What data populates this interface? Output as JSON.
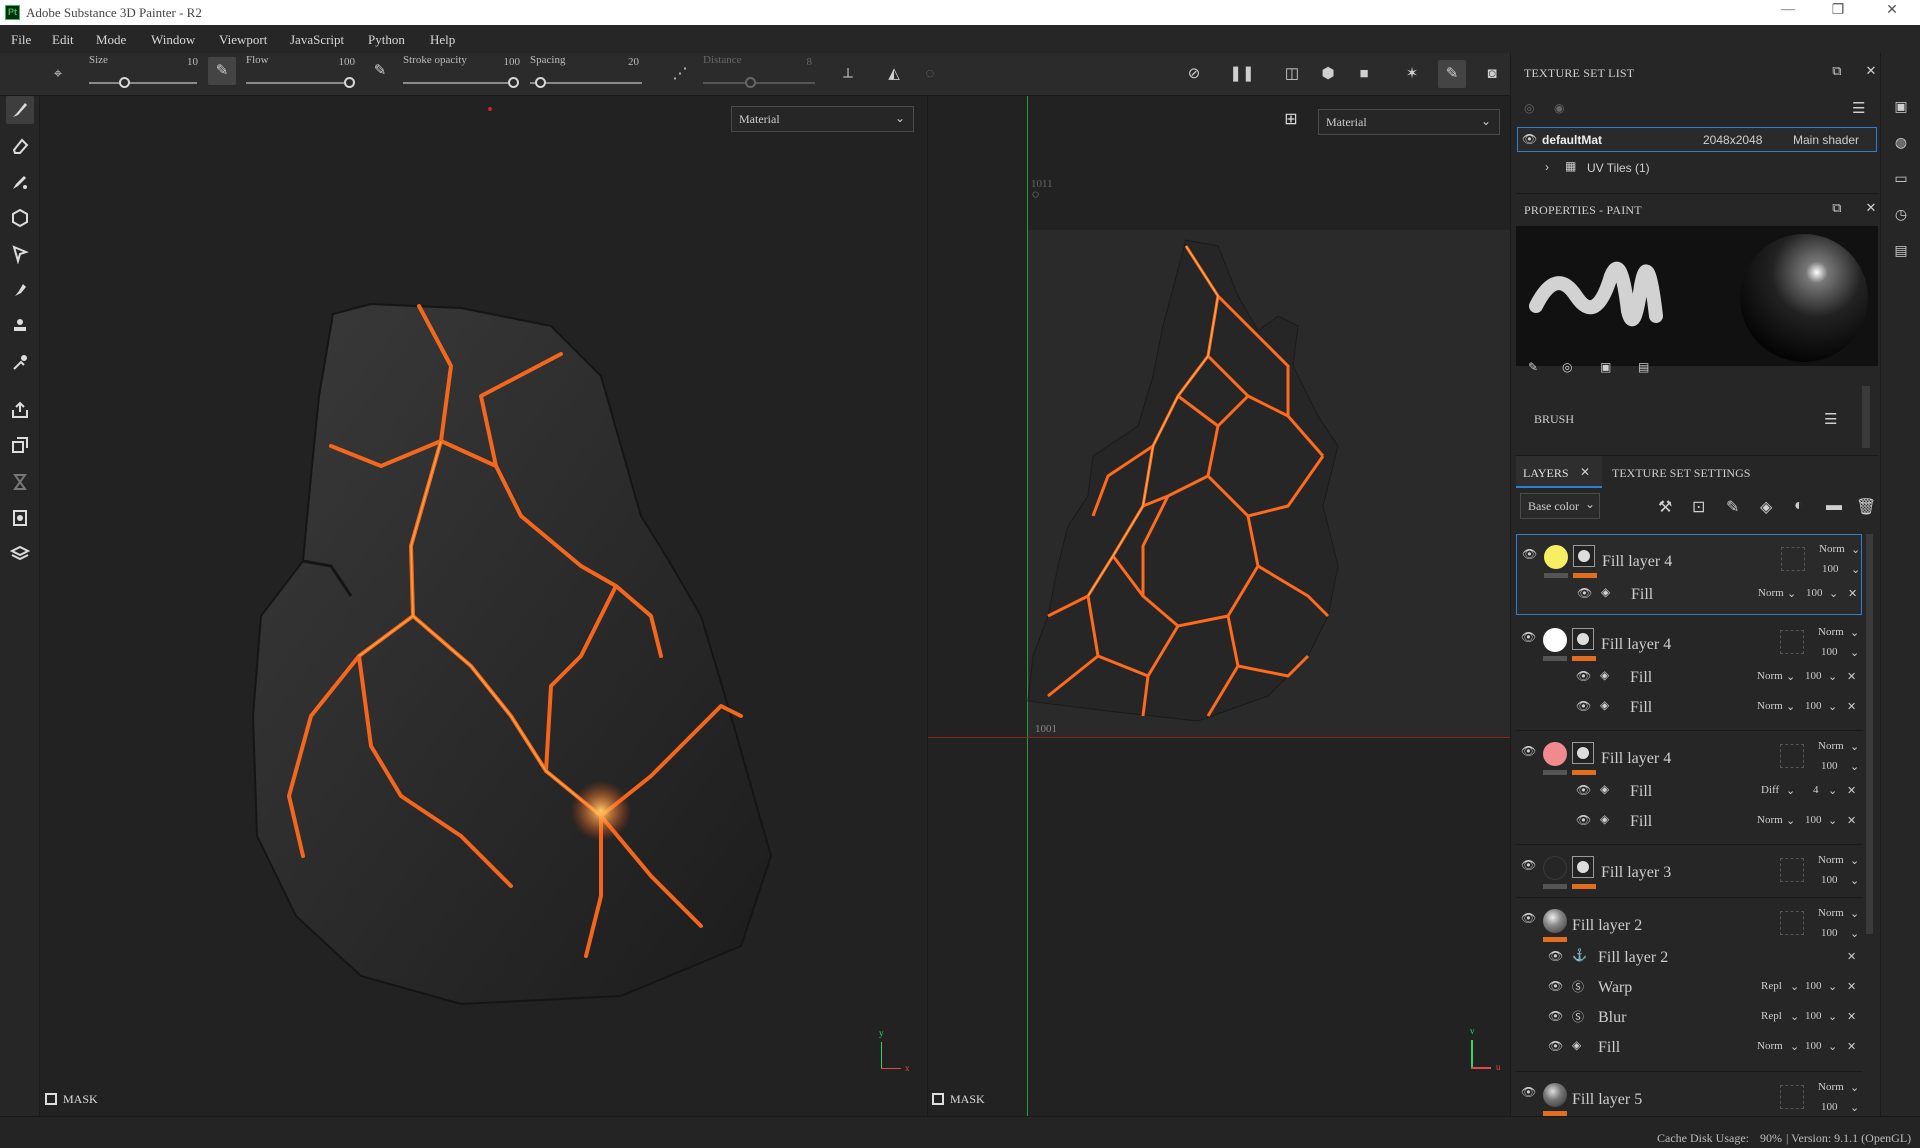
{
  "window": {
    "title": "Adobe Substance 3D Painter - R2",
    "logo": "Pt"
  },
  "menu": [
    "File",
    "Edit",
    "Mode",
    "Window",
    "Viewport",
    "JavaScript",
    "Python",
    "Help"
  ],
  "toolbar": {
    "size_label": "Size",
    "size_value": "10",
    "flow_label": "Flow",
    "flow_value": "100",
    "stroke_opacity_label": "Stroke opacity",
    "stroke_opacity_value": "100",
    "spacing_label": "Spacing",
    "spacing_value": "20",
    "distance_label": "Distance",
    "distance_value": "8"
  },
  "viewport3d": {
    "mode_select": "Material",
    "mask_label": "MASK",
    "axis_y": "y",
    "axis_x": "x"
  },
  "viewport2d": {
    "mode_select": "Material",
    "mask_label": "MASK",
    "tile_top": "1011",
    "tile_label": "1001",
    "axis_v": "v",
    "axis_u": "u"
  },
  "texture_set_list": {
    "title": "TEXTURE SET LIST",
    "set_name": "defaultMat",
    "resolution": "2048x2048",
    "shader": "Main shader",
    "uv_tiles": "UV Tiles (1)"
  },
  "properties": {
    "title": "PROPERTIES - PAINT",
    "brush_label": "BRUSH"
  },
  "tabs": {
    "layers": "LAYERS",
    "texture_set_settings": "TEXTURE SET SETTINGS"
  },
  "channel_select": "Base color",
  "layers": [
    {
      "name": "Fill layer 4",
      "blend": "Norm",
      "opacity": "100",
      "thumb": "#f6ee63",
      "selected": true,
      "children": [
        {
          "name": "Fill",
          "blend": "Norm",
          "opacity": "100"
        }
      ]
    },
    {
      "name": "Fill layer 4",
      "blend": "Norm",
      "opacity": "100",
      "thumb": "#ffffff",
      "children": [
        {
          "name": "Fill",
          "blend": "Norm",
          "opacity": "100"
        },
        {
          "name": "Fill",
          "blend": "Norm",
          "opacity": "100"
        }
      ]
    },
    {
      "name": "Fill layer 4",
      "blend": "Norm",
      "opacity": "100",
      "thumb": "#f08a8f",
      "children": [
        {
          "name": "Fill",
          "blend": "Diff",
          "opacity": "4"
        },
        {
          "name": "Fill",
          "blend": "Norm",
          "opacity": "100"
        }
      ]
    },
    {
      "name": "Fill layer 3",
      "blend": "Norm",
      "opacity": "100",
      "thumb": "#262626"
    },
    {
      "name": "Fill layer 2",
      "blend": "Norm",
      "opacity": "100",
      "thumb": "#b0b0b0",
      "effects": [
        {
          "name": "Fill layer 2",
          "blend": "",
          "opacity": "",
          "icon": "anchor-icon"
        },
        {
          "name": "Warp",
          "blend": "Repl",
          "opacity": "100",
          "icon": "substance-icon"
        },
        {
          "name": "Blur",
          "blend": "Repl",
          "opacity": "100",
          "icon": "substance-icon"
        },
        {
          "name": "Fill",
          "blend": "Norm",
          "opacity": "100",
          "icon": "fill-icon"
        }
      ]
    },
    {
      "name": "Fill layer 5",
      "blend": "Norm",
      "opacity": "100",
      "thumb": "#9a9a9a"
    }
  ],
  "status": {
    "cache_label": "Cache Disk Usage:",
    "cache_value": "90%",
    "version": "| Version: 9.1.1 (OpenGL)"
  },
  "colors": {
    "accent": "#2d7fd3",
    "opacity_bar": "#e16e1e",
    "lava": "#ff5a1a",
    "rock": "#2a2a2a"
  }
}
